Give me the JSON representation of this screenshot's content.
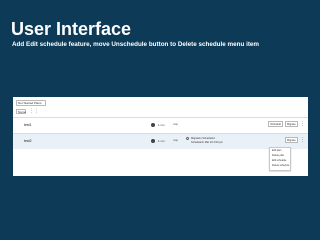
{
  "slide": {
    "title": "User Interface",
    "subtitle": "Add Edit schedule feature, move Unschedule button to Delete schedule menu item"
  },
  "controls": {
    "dropdown_label": "Not Started Plans",
    "name_select": "Name"
  },
  "rows": [
    {
      "name": "test1",
      "duration": "1 vm",
      "tag": "map",
      "schedule_button": "Schedule",
      "migrate_button": "Migrate"
    },
    {
      "name": "test2",
      "duration": "1 vm",
      "tag": "map",
      "schedule_line1": "Migration Scheduled",
      "schedule_line2": "Scheduled: Mar 10 2:00 pm",
      "migrate_button": "Migrate"
    }
  ],
  "menu": {
    "items": [
      "Edit plan",
      "Delete plan",
      "Edit schedule",
      "Delete schedule"
    ]
  },
  "colors": {
    "background": "#0d3a57",
    "row_highlight": "#e9f0f7"
  }
}
